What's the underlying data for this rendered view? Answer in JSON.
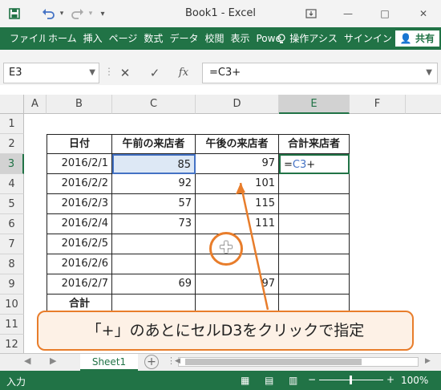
{
  "titlebar": {
    "title": "Book1 - Excel",
    "minimize": "—",
    "maximize": "□",
    "close": "✕"
  },
  "ribbon": {
    "tabs": [
      "ファイル",
      "ホーム",
      "挿入",
      "ページ",
      "数式",
      "データ",
      "校閲",
      "表示",
      "Powe"
    ],
    "search": "操作アシス",
    "signin": "サインイン",
    "share": "共有"
  },
  "formula_bar": {
    "name_box": "E3",
    "fx": "fx",
    "formula": "=C3+"
  },
  "columns": [
    "A",
    "B",
    "C",
    "D",
    "E",
    "F"
  ],
  "rows": [
    "1",
    "2",
    "3",
    "4",
    "5",
    "6",
    "7",
    "8",
    "9",
    "10",
    "11",
    "12"
  ],
  "table": {
    "headers": [
      "日付",
      "午前の来店者",
      "午後の来店者",
      "合計来店者"
    ],
    "rows": [
      {
        "date": "2016/2/1",
        "am": "85",
        "pm": "97",
        "total": "=C3+"
      },
      {
        "date": "2016/2/2",
        "am": "92",
        "pm": "101",
        "total": ""
      },
      {
        "date": "2016/2/3",
        "am": "57",
        "pm": "115",
        "total": ""
      },
      {
        "date": "2016/2/4",
        "am": "73",
        "pm": "111",
        "total": ""
      },
      {
        "date": "2016/2/5",
        "am": "",
        "pm": "",
        "total": ""
      },
      {
        "date": "2016/2/6",
        "am": "",
        "pm": "",
        "total": ""
      },
      {
        "date": "2016/2/7",
        "am": "69",
        "pm": "97",
        "total": ""
      }
    ],
    "total_label": "合計"
  },
  "callout": "「+」のあとにセルD3をクリックで指定",
  "sheets": [
    "Sheet1"
  ],
  "status": {
    "mode": "入力",
    "zoom": "100%"
  },
  "colors": {
    "excel_green": "#217346",
    "callout_orange": "#e87d2b",
    "ref_blue": "#4472c4"
  }
}
